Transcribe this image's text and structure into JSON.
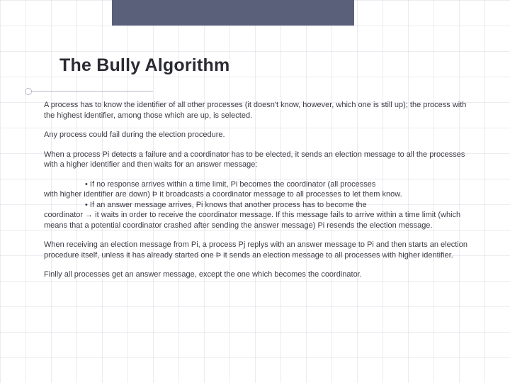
{
  "title": "The Bully Algorithm",
  "p1": "A process has to know the identifier of all other processes (it doesn't know, however, which one is still up); the process with the highest identifier, among those which are up, is selected.",
  "p2": "Any process could fail during the election procedure.",
  "p3": "When a process Pi detects a failure and a coordinator has to be elected, it sends an election message to all the processes with a higher identifier and then waits for an answer message:",
  "b1a": "• If no response arrives within a time limit, Pi becomes the coordinator (all processes",
  "b1b": "with higher identifier are down) Þ it broadcasts a coordinator message to all processes to let them know.",
  "b2a": "• If an answer message arrives, Pi knows that another process has to become the",
  "b2b": "coordinator → it waits in order to receive the coordinator message. If this message fails to arrive within a time limit (which means that a potential coordinator crashed after sending the answer message) Pi resends the election message.",
  "p4": "When receiving an election message from Pi, a process Pj replys with an answer message to Pi and then starts an election procedure itself, unless it has already started one Þ it sends an election message to all processes with higher identifier.",
  "p5": "Finlly all processes get an answer message, except the one which becomes the coordinator."
}
